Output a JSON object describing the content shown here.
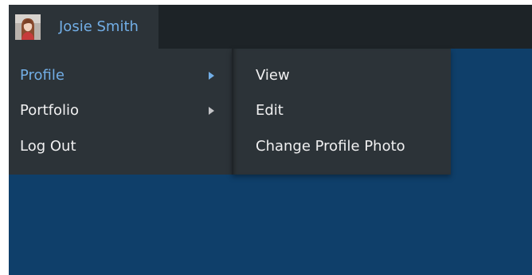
{
  "user": {
    "name": "Josie Smith"
  },
  "menu": {
    "items": [
      {
        "label": "Profile",
        "has_submenu": true,
        "active": true
      },
      {
        "label": "Portfolio",
        "has_submenu": true,
        "active": false
      },
      {
        "label": "Log Out",
        "has_submenu": false,
        "active": false
      }
    ]
  },
  "submenu": {
    "items": [
      {
        "label": "View"
      },
      {
        "label": "Edit"
      },
      {
        "label": "Change Profile Photo"
      }
    ]
  },
  "colors": {
    "admin_bar": "#1d2327",
    "menu_bg": "#2c3338",
    "accent": "#72aee6",
    "page_bg": "#0f3f6a",
    "text": "#f0f0f1"
  }
}
